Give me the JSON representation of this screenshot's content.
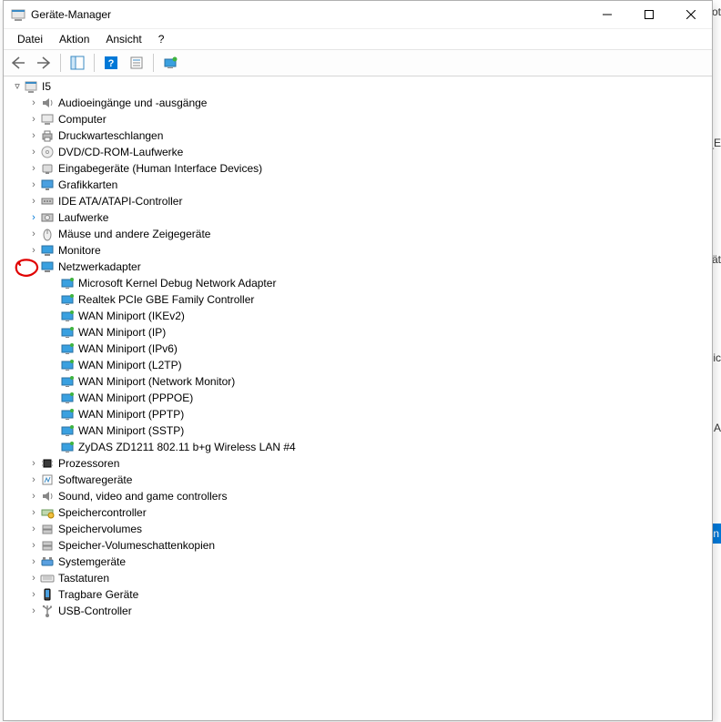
{
  "window": {
    "title": "Geräte-Manager"
  },
  "menu": {
    "file": "Datei",
    "action": "Aktion",
    "view": "Ansicht",
    "help": "?"
  },
  "root": {
    "name": "I5"
  },
  "categories": [
    {
      "label": "Audioeingänge und -ausgänge",
      "icon": "audio"
    },
    {
      "label": "Computer",
      "icon": "computer"
    },
    {
      "label": "Druckwarteschlangen",
      "icon": "printer"
    },
    {
      "label": "DVD/CD-ROM-Laufwerke",
      "icon": "disc"
    },
    {
      "label": "Eingabegeräte (Human Interface Devices)",
      "icon": "hid"
    },
    {
      "label": "Grafikkarten",
      "icon": "display"
    },
    {
      "label": "IDE ATA/ATAPI-Controller",
      "icon": "ide"
    },
    {
      "label": "Laufwerke",
      "icon": "drive",
      "chev_blue": true
    },
    {
      "label": "Mäuse und andere Zeigegeräte",
      "icon": "mouse"
    },
    {
      "label": "Monitore",
      "icon": "monitor"
    }
  ],
  "network": {
    "label": "Netzwerkadapter",
    "devices": [
      "Microsoft Kernel Debug Network Adapter",
      "Realtek PCIe GBE Family Controller",
      "WAN Miniport (IKEv2)",
      "WAN Miniport (IP)",
      "WAN Miniport (IPv6)",
      "WAN Miniport (L2TP)",
      "WAN Miniport (Network Monitor)",
      "WAN Miniport (PPPOE)",
      "WAN Miniport (PPTP)",
      "WAN Miniport (SSTP)",
      "ZyDAS ZD1211 802.11 b+g Wireless LAN #4"
    ]
  },
  "categories_after": [
    {
      "label": "Prozessoren",
      "icon": "cpu"
    },
    {
      "label": "Softwaregeräte",
      "icon": "software"
    },
    {
      "label": "Sound, video and game controllers",
      "icon": "audio"
    },
    {
      "label": "Speichercontroller",
      "icon": "storagectrl"
    },
    {
      "label": "Speichervolumes",
      "icon": "volume"
    },
    {
      "label": "Speicher-Volumeschattenkopien",
      "icon": "volume"
    },
    {
      "label": "Systemgeräte",
      "icon": "system"
    },
    {
      "label": "Tastaturen",
      "icon": "keyboard"
    },
    {
      "label": "Tragbare Geräte",
      "icon": "portable"
    },
    {
      "label": "USB-Controller",
      "icon": "usb"
    }
  ],
  "bg": {
    "f1": "ot",
    "f2": "_E",
    "f3": "rät",
    "f4": "Sic",
    "f5": "A",
    "f6": "n"
  }
}
